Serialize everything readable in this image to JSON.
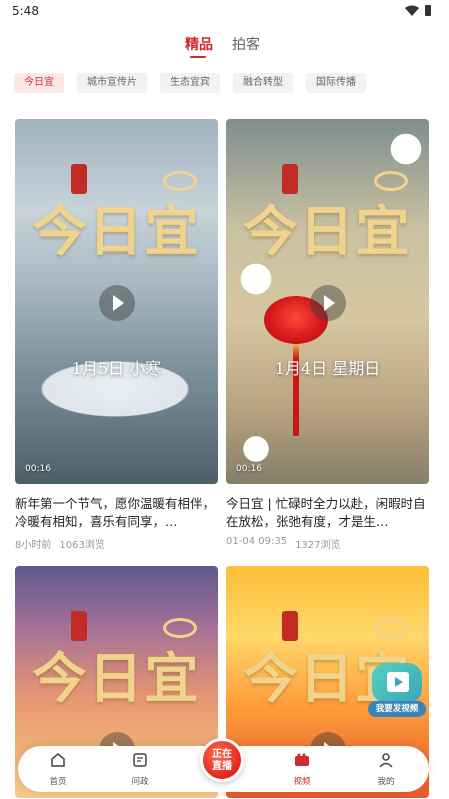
{
  "status_bar": {
    "time": "5:48"
  },
  "top_tabs": [
    {
      "label": "精品",
      "active": true
    },
    {
      "label": "拍客",
      "active": false
    }
  ],
  "category_chips": [
    {
      "label": "今日宜",
      "active": true
    },
    {
      "label": "城市宣传片",
      "active": false
    },
    {
      "label": "生态宜宾",
      "active": false
    },
    {
      "label": "融合转型",
      "active": false
    },
    {
      "label": "国际传播",
      "active": false
    }
  ],
  "videos": [
    {
      "overlay_title": "今日宜",
      "overlay_caption": "1月5日 小寒",
      "duration": "00:16",
      "title": "新年第一个节气，愿你温暖有相伴，冷暖有相知，喜乐有同享，…",
      "time": "8小时前",
      "views": "1063浏览"
    },
    {
      "overlay_title": "今日宜",
      "overlay_caption": "1月4日 星期日",
      "duration": "00:16",
      "title": "今日宜 | 忙碌时全力以赴，闲暇时自在放松，张弛有度，才是生…",
      "time": "01-04 09:35",
      "views": "1327浏览"
    },
    {
      "overlay_title": "今日宜"
    },
    {
      "overlay_title": "今日宜"
    }
  ],
  "fab": {
    "label": "我要发视频"
  },
  "bottom_nav": {
    "items": [
      {
        "label": "首页",
        "icon": "home-icon"
      },
      {
        "label": "问政",
        "icon": "inquiry-icon"
      },
      {
        "label": "视频",
        "icon": "video-icon",
        "active": true
      },
      {
        "label": "我的",
        "icon": "profile-icon"
      }
    ],
    "live_label_line1": "正在",
    "live_label_line2": "直播"
  },
  "colors": {
    "accent": "#d32a2a",
    "gold": "#f0d48d",
    "fab": "#3aa6b9"
  }
}
